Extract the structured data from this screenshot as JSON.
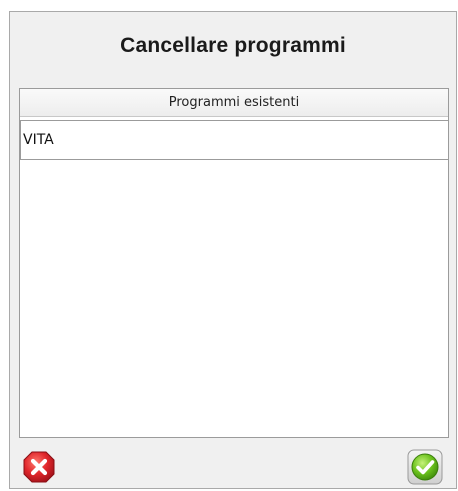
{
  "dialog": {
    "title": "Cancellare programmi"
  },
  "list": {
    "header": "Programmi esistenti",
    "items": [
      {
        "label": "VITA"
      }
    ]
  },
  "buttons": {
    "cancel_icon": "close-icon",
    "confirm_icon": "check-icon"
  },
  "colors": {
    "cancel": "#d9252a",
    "confirm": "#6cc21e",
    "panel_background": "#f0f0f0"
  }
}
